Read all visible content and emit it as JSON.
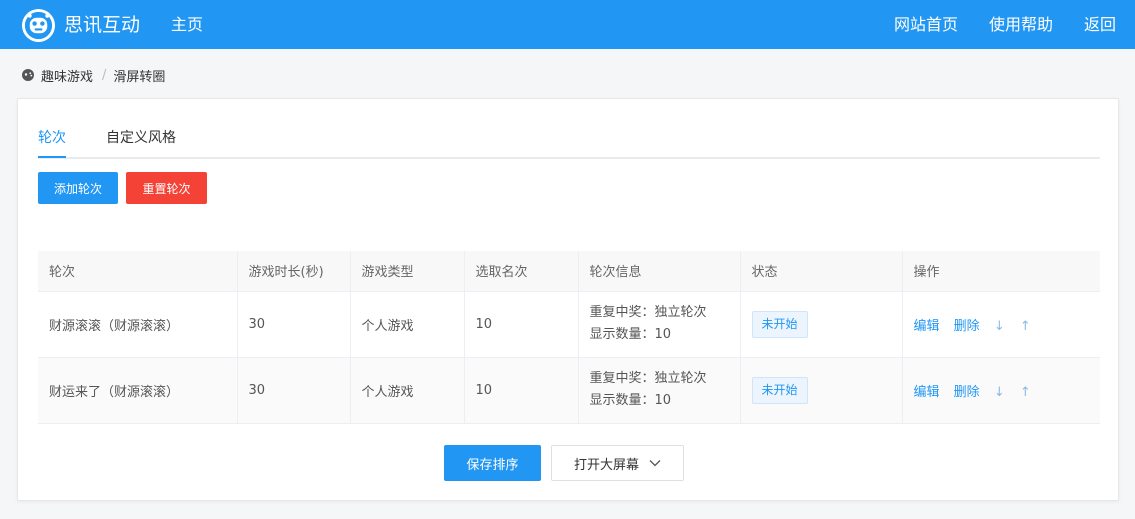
{
  "header": {
    "brand": "思讯互动",
    "home": "主页",
    "nav_right": [
      "网站首页",
      "使用帮助",
      "返回"
    ]
  },
  "breadcrumb": {
    "parent": "趣味游戏",
    "separator": "/",
    "current": "滑屏转圈"
  },
  "tabs": [
    "轮次",
    "自定义风格"
  ],
  "toolbar": {
    "add_label": "添加轮次",
    "reset_label": "重置轮次"
  },
  "table": {
    "columns": [
      "轮次",
      "游戏时长(秒)",
      "游戏类型",
      "选取名次",
      "轮次信息",
      "状态",
      "操作"
    ],
    "rows": [
      {
        "name": "财源滚滚（财源滚滚）",
        "duration": "30",
        "type": "个人游戏",
        "rank": "10",
        "info1": "重复中奖：独立轮次",
        "info2": "显示数量：10",
        "status": "未开始"
      },
      {
        "name": "财运来了（财源滚滚）",
        "duration": "30",
        "type": "个人游戏",
        "rank": "10",
        "info1": "重复中奖：独立轮次",
        "info2": "显示数量：10",
        "status": "未开始"
      }
    ],
    "ops": {
      "edit": "编辑",
      "delete": "删除",
      "down": "↓",
      "up": "↑"
    }
  },
  "footer": {
    "save_label": "保存排序",
    "screen_label": "打开大屏幕"
  },
  "colors": {
    "primary": "#2196f3",
    "danger": "#f44336"
  },
  "icons": {
    "logo": "robot-logo-icon",
    "breadcrumb": "gamepad-icon",
    "dropdown": "chevron-down-icon"
  }
}
